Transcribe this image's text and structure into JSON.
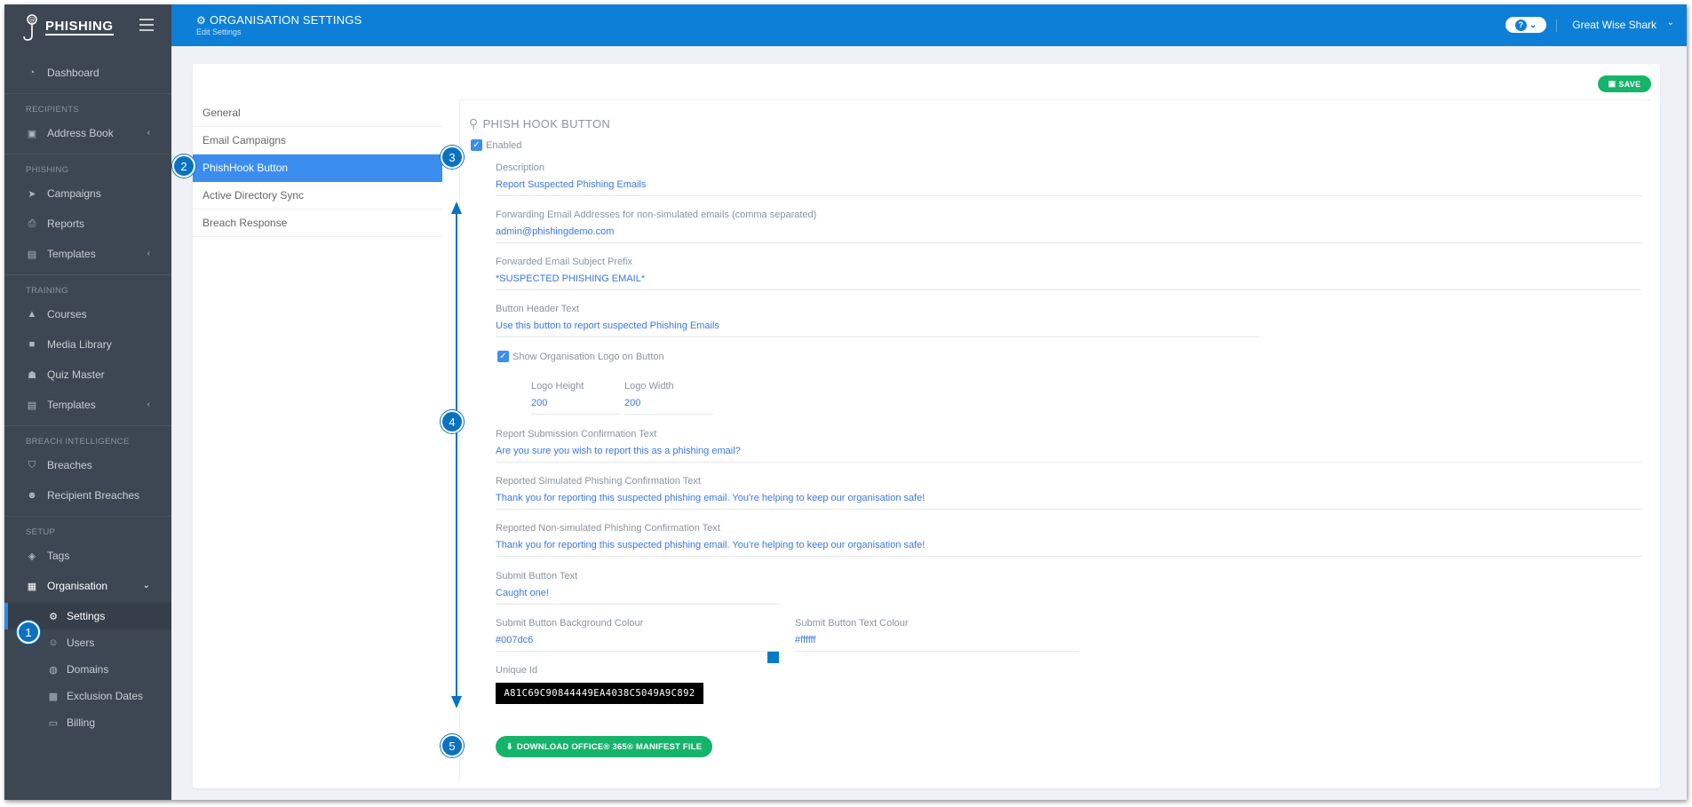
{
  "brand": {
    "name": "PHISHING"
  },
  "sidebar": {
    "dashboard": "Dashboard",
    "sections": {
      "recipients": "RECIPIENTS",
      "phishing": "PHISHING",
      "training": "TRAINING",
      "breach": "BREACH INTELLIGENCE",
      "setup": "SETUP"
    },
    "items": {
      "address_book": "Address Book",
      "campaigns": "Campaigns",
      "reports": "Reports",
      "templates_phishing": "Templates",
      "courses": "Courses",
      "media_library": "Media Library",
      "quiz_master": "Quiz Master",
      "templates_training": "Templates",
      "breaches": "Breaches",
      "recipient_breaches": "Recipient Breaches",
      "tags": "Tags",
      "organisation": "Organisation",
      "settings": "Settings",
      "users": "Users",
      "domains": "Domains",
      "exclusion_dates": "Exclusion Dates",
      "billing": "Billing"
    }
  },
  "header": {
    "title": "ORGANISATION SETTINGS",
    "subtitle": "Edit Settings",
    "user": "Great Wise Shark"
  },
  "toolbar": {
    "save_label": "SAVE"
  },
  "tabs": [
    "General",
    "Email Campaigns",
    "PhishHook Button",
    "Active Directory Sync",
    "Breach Response"
  ],
  "panel": {
    "title": "PHISH HOOK BUTTON",
    "enabled_label": "Enabled",
    "description": {
      "label": "Description",
      "value": "Report Suspected Phishing Emails"
    },
    "forwarding": {
      "label": "Forwarding Email Addresses for non-simulated emails (comma separated)",
      "value": "admin@phishingdemo.com"
    },
    "subject_prefix": {
      "label": "Forwarded Email Subject Prefix",
      "value": "*SUSPECTED PHISHING EMAIL*"
    },
    "header_text": {
      "label": "Button Header Text",
      "value": "Use this button to report suspected Phishing Emails"
    },
    "show_logo_label": "Show Organisation Logo on Button",
    "logo_height": {
      "label": "Logo Height",
      "value": "200"
    },
    "logo_width": {
      "label": "Logo Width",
      "value": "200"
    },
    "submission_confirm": {
      "label": "Report Submission Confirmation Text",
      "value": "Are you sure you wish to report this as a phishing email?"
    },
    "simulated_confirm": {
      "label": "Reported Simulated Phishing Confirmation Text",
      "value": "Thank you for reporting this suspected phishing email. You're helping to keep our organisation safe!"
    },
    "nonsimulated_confirm": {
      "label": "Reported Non-simulated Phishing Confirmation Text",
      "value": "Thank you for reporting this suspected phishing email. You're helping to keep our organisation safe!"
    },
    "submit_text": {
      "label": "Submit Button Text",
      "value": "Caught one!"
    },
    "submit_bg": {
      "label": "Submit Button Background Colour",
      "value": "#007dc6"
    },
    "submit_fg": {
      "label": "Submit Button Text Colour",
      "value": "#ffffff"
    },
    "unique_id": {
      "label": "Unique Id",
      "value": "A81C69C90844449EA4038C5049A9C892"
    },
    "download_label": "DOWNLOAD OFFICE® 365® MANIFEST FILE"
  },
  "callouts": [
    "1",
    "2",
    "3",
    "4",
    "5"
  ],
  "colors": {
    "primary": "#0d7fd6",
    "sidebar": "#3d4753",
    "success": "#16b36b",
    "swatch": "#007dc6",
    "active_tab": "#3b8eef"
  }
}
